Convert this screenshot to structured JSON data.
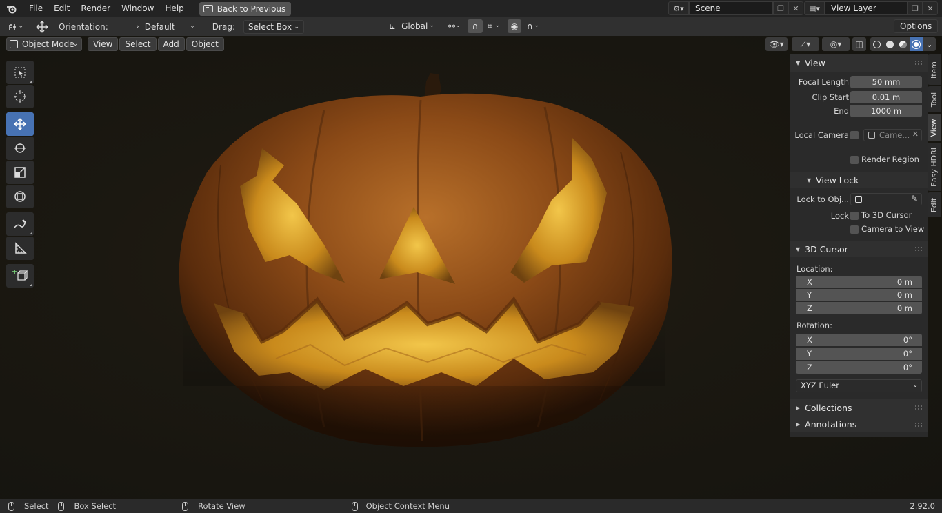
{
  "topbar": {
    "menus": [
      "File",
      "Edit",
      "Render",
      "Window",
      "Help"
    ],
    "back_button": "Back to Previous",
    "scene_name": "Scene",
    "view_layer": "View Layer"
  },
  "toolheader": {
    "orientation_label": "Orientation:",
    "orientation_value": "Default",
    "drag_label": "Drag:",
    "drag_value": "Select Box",
    "transform_orientation": "Global",
    "options_label": "Options"
  },
  "viewport": {
    "mode": "Object Mode",
    "menus": [
      "View",
      "Select",
      "Add",
      "Object"
    ]
  },
  "tools": [
    "select-box",
    "cursor",
    "move",
    "rotate",
    "scale",
    "transform",
    "annotate",
    "measure",
    "add-cube"
  ],
  "sidebar": {
    "tabs": [
      "Item",
      "Tool",
      "View",
      "Easy HDRI",
      "Edit"
    ],
    "active_tab": "View",
    "view_panel": {
      "title": "View",
      "focal_length_label": "Focal Length",
      "focal_length": "50 mm",
      "clip_start_label": "Clip Start",
      "clip_start": "0.01 m",
      "end_label": "End",
      "end": "1000 m",
      "local_camera_label": "Local Camera",
      "local_camera_placeholder": "Came...",
      "render_region_label": "Render Region"
    },
    "view_lock": {
      "title": "View Lock",
      "lock_to_object_label": "Lock to Obj...",
      "lock_label": "Lock",
      "to_3d_cursor_label": "To 3D Cursor",
      "camera_to_view_label": "Camera to View"
    },
    "cursor_panel": {
      "title": "3D Cursor",
      "location_label": "Location:",
      "location": [
        {
          "axis": "X",
          "value": "0 m"
        },
        {
          "axis": "Y",
          "value": "0 m"
        },
        {
          "axis": "Z",
          "value": "0 m"
        }
      ],
      "rotation_label": "Rotation:",
      "rotation": [
        {
          "axis": "X",
          "value": "0°"
        },
        {
          "axis": "Y",
          "value": "0°"
        },
        {
          "axis": "Z",
          "value": "0°"
        }
      ],
      "rotation_mode": "XYZ Euler"
    },
    "collections_title": "Collections",
    "annotations_title": "Annotations"
  },
  "statusbar": {
    "select": "Select",
    "box_select": "Box Select",
    "rotate_view": "Rotate View",
    "context_menu": "Object Context Menu",
    "version": "2.92.0"
  },
  "colors": {
    "accent": "#4772b3",
    "pumpkin_body": "#8a4a16",
    "pumpkin_glow": "#e0a82a"
  }
}
